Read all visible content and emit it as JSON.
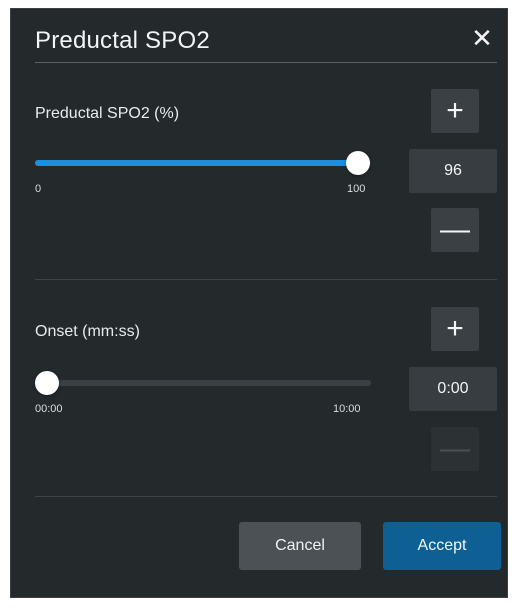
{
  "dialog": {
    "title": "Preductal SPO2",
    "close_icon": "close-icon",
    "close_glyph": "✕"
  },
  "spo2": {
    "label": "Preductal SPO2 (%)",
    "min_label": "0",
    "max_label": "100",
    "value": "96",
    "fraction": 0.96,
    "increment_glyph": "+",
    "decrement_glyph": "—"
  },
  "onset": {
    "label": "Onset (mm:ss)",
    "min_label": "00:00",
    "max_label": "10:00",
    "value": "0:00",
    "fraction": 0,
    "increment_glyph": "+",
    "decrement_glyph": "—"
  },
  "actions": {
    "cancel_label": "Cancel",
    "accept_label": "Accept"
  },
  "colors": {
    "accent": "#1e8fdd",
    "accept_button": "#0e5f93",
    "dialog_background": "#24292c"
  }
}
